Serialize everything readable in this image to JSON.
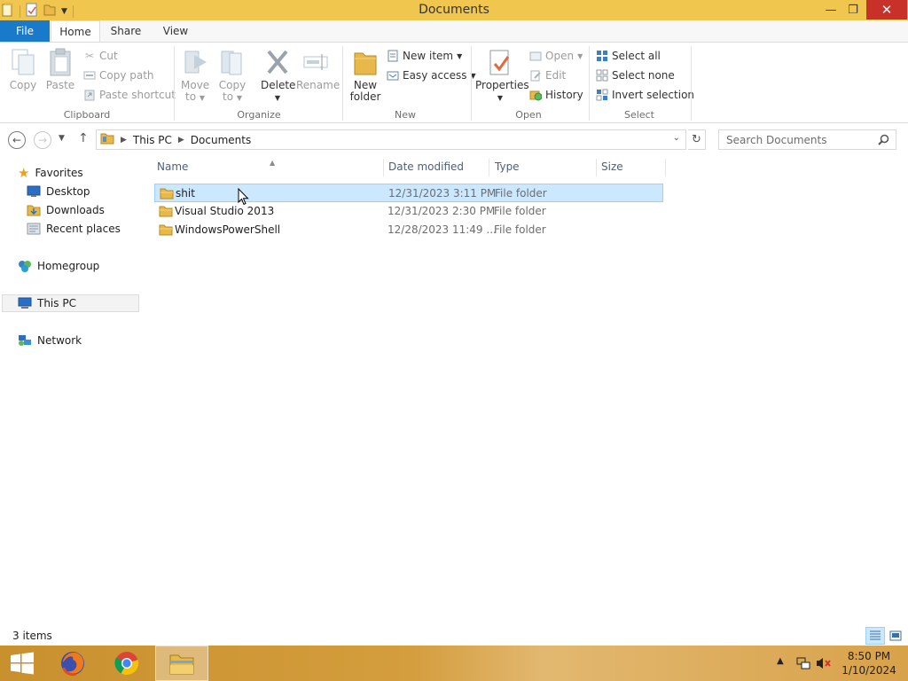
{
  "window": {
    "title": "Documents",
    "minimize_icon": "minimize-icon",
    "maximize_icon": "restore-icon",
    "close_icon": "close-icon"
  },
  "ribbon_tabs": [
    {
      "label": "File",
      "active": false
    },
    {
      "label": "Home",
      "active": true
    },
    {
      "label": "Share",
      "active": false
    },
    {
      "label": "View",
      "active": false
    }
  ],
  "ribbon": {
    "clipboard": {
      "label": "Clipboard",
      "copy": "Copy",
      "paste": "Paste",
      "cut": "Cut",
      "copy_path": "Copy path",
      "paste_shortcut": "Paste shortcut"
    },
    "organize": {
      "label": "Organize",
      "move_to_1": "Move",
      "move_to_2": "to",
      "copy_to_1": "Copy",
      "copy_to_2": "to",
      "delete": "Delete",
      "rename": "Rename"
    },
    "new": {
      "label": "New",
      "new_folder_1": "New",
      "new_folder_2": "folder",
      "new_item": "New item",
      "easy_access": "Easy access"
    },
    "open": {
      "label": "Open",
      "properties": "Properties",
      "open": "Open",
      "edit": "Edit",
      "history": "History"
    },
    "select": {
      "label": "Select",
      "select_all": "Select all",
      "select_none": "Select none",
      "invert_selection": "Invert selection"
    }
  },
  "address": {
    "crumbs": [
      "This PC",
      "Documents"
    ],
    "search_placeholder": "Search Documents"
  },
  "nav_pane": {
    "favorites": "Favorites",
    "desktop": "Desktop",
    "downloads": "Downloads",
    "recent_places": "Recent places",
    "homegroup": "Homegroup",
    "this_pc": "This PC",
    "network": "Network"
  },
  "columns": {
    "name": "Name",
    "date_modified": "Date modified",
    "type": "Type",
    "size": "Size"
  },
  "files": [
    {
      "name": "shit",
      "date": "12/31/2023 3:11 PM",
      "type": "File folder",
      "size": "",
      "selected": true
    },
    {
      "name": "Visual Studio 2013",
      "date": "12/31/2023 2:30 PM",
      "type": "File folder",
      "size": "",
      "selected": false
    },
    {
      "name": "WindowsPowerShell",
      "date": "12/28/2023 11:49 ...",
      "type": "File folder",
      "size": "",
      "selected": false
    }
  ],
  "status": {
    "item_count": "3 items"
  },
  "taskbar": {
    "time": "8:50 PM",
    "date": "1/10/2024"
  },
  "colors": {
    "title_bar": "#f0c64f",
    "file_tab": "#1979ca",
    "close_button": "#c7312a",
    "selection": "#cce8ff",
    "selection_border": "#99d1ff",
    "folder": "#e8b94a"
  }
}
